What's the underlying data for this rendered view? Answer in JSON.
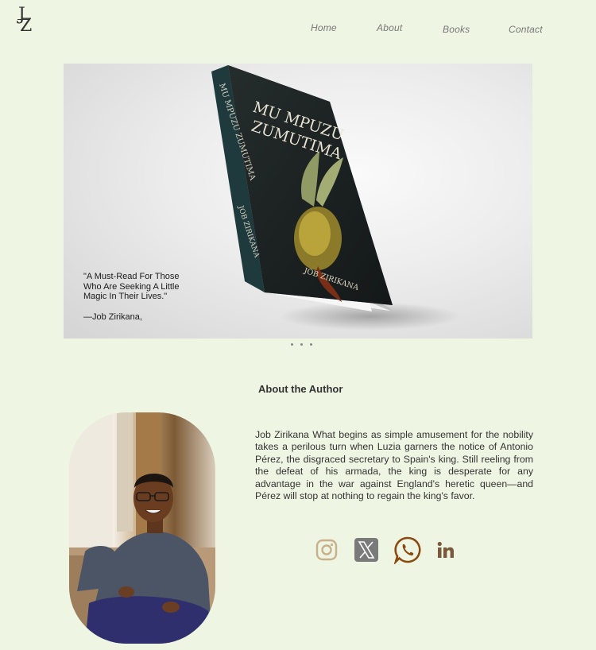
{
  "logo": {
    "letter_top": "J",
    "letter_bottom": "Z"
  },
  "nav": {
    "home": "Home",
    "about": "About",
    "books": "Books",
    "contact": "Contact"
  },
  "hero": {
    "book_title_line1": "MU MPUZU",
    "book_title_line2": "ZUMUTIMA",
    "book_spine_title": "MU MPUZU ZUMUTIMA",
    "book_spine_author": "JOB ZIRIKANA",
    "book_author": "JOB ZIRIKANA",
    "quote": "\"A Must-Read For Those Who Are Seeking A Little Magic In Their Lives.\"",
    "attribution": "—Job Zirikana,"
  },
  "about": {
    "heading": "About the Author",
    "bio": "Job Zirikana What begins as simple amusement for the nobility takes a perilous turn when Luzia garners the notice of Antonio Pérez, the disgraced secretary to Spain's king. Still reeling from  the defeat of his armada, the king is desperate for any advantage in the war against England's heretic queen—and Pérez will stop at nothing to regain the king's favor."
  },
  "socials": [
    "instagram-icon",
    "x-twitter-icon",
    "whatsapp-icon",
    "linkedin-icon"
  ],
  "colors": {
    "background": "#eef5e3",
    "instagram": "#c8b08a",
    "x": "#7a7a7a",
    "whatsapp": "#8a4a12",
    "linkedin": "#7a5a3a"
  }
}
